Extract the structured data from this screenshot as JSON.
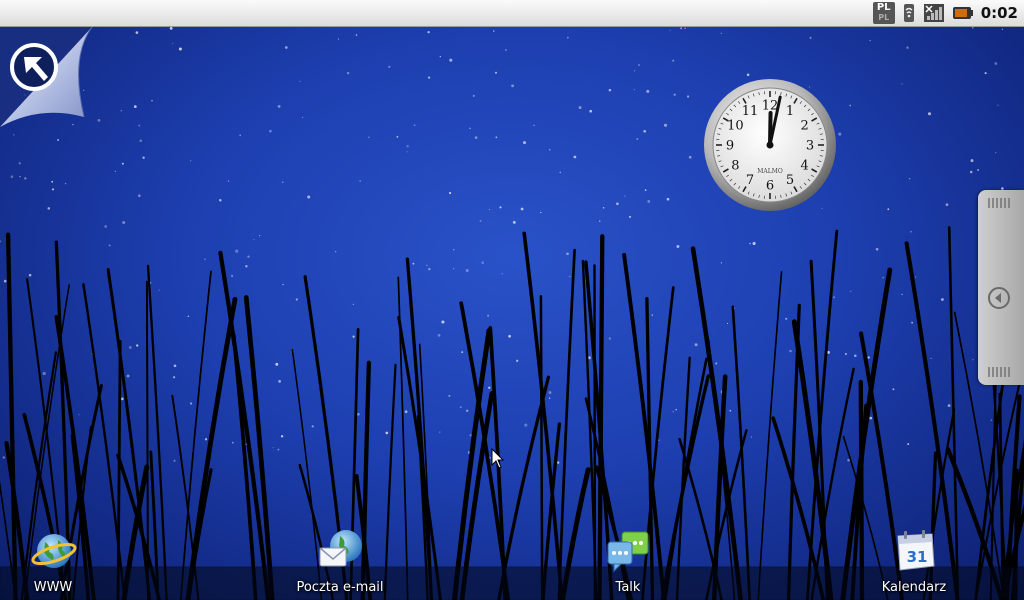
{
  "status_bar": {
    "time": "0:02",
    "input_method": "PL",
    "icons": [
      "keyboard-pl-icon",
      "wifi-icon",
      "signal-icon",
      "battery-icon"
    ]
  },
  "home": {
    "clock_widget": {
      "brand": "MALMO",
      "numerals": [
        "12",
        "1",
        "2",
        "3",
        "4",
        "5",
        "6",
        "7",
        "8",
        "9",
        "10",
        "11"
      ],
      "time": "0:02"
    },
    "shortcuts": [
      {
        "label": "WWW",
        "icon": "browser-globe-icon"
      },
      {
        "label": "Poczta e-mail",
        "icon": "email-icon"
      },
      {
        "label": "Talk",
        "icon": "talk-chat-icon"
      },
      {
        "label": "Kalendarz",
        "icon": "calendar-icon",
        "day": "31"
      }
    ]
  },
  "colors": {
    "wallpaper": "#1d3fb0",
    "status_bar": "#e8e8e8"
  }
}
